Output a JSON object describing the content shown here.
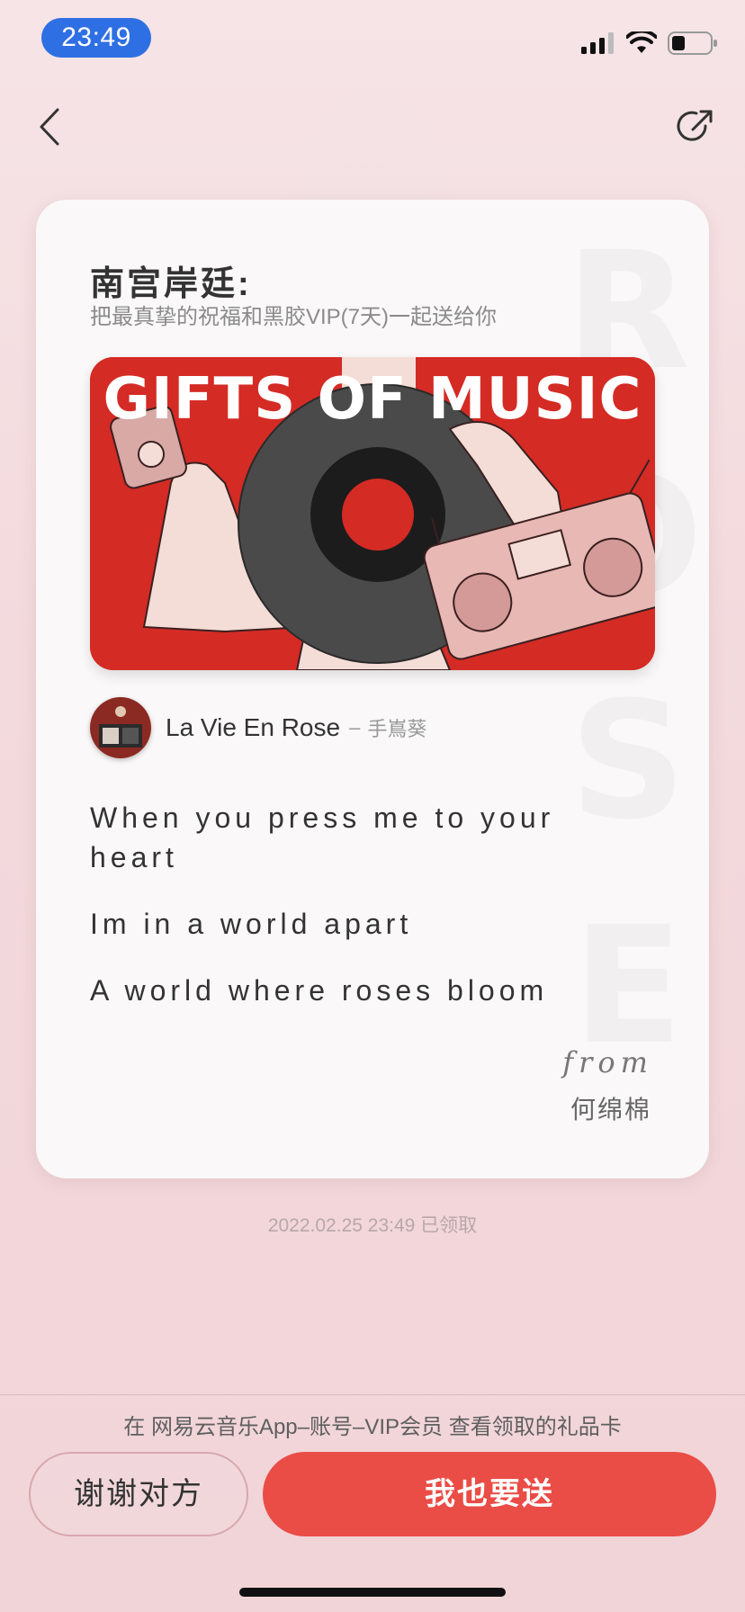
{
  "status_bar": {
    "time": "23:49",
    "signal_icon": "cellular-signal-icon",
    "wifi_icon": "wifi-icon",
    "battery_icon": "battery-icon",
    "battery_level": 0.3
  },
  "nav": {
    "back_icon": "chevron-left-icon",
    "share_icon": "share-arrow-icon"
  },
  "card": {
    "recipient": "南宫岸廷:",
    "subtitle": "把最真挚的祝福和黑胶VIP(7天)一起送给你",
    "banner_title": "GIFTS OF MUSIC",
    "watermark_letters": [
      "R",
      "O",
      "S",
      "E"
    ],
    "song": {
      "title": "La Vie En Rose",
      "separator": "–",
      "artist": "手嶌葵"
    },
    "lyrics": [
      "When you press me to your heart",
      "Im in a world apart",
      "A world where roses bloom"
    ],
    "from_label": "from",
    "from_name": "何绵棉"
  },
  "claimed_info": "2022.02.25 23:49 已领取",
  "footer": {
    "tip": "在 网易云音乐App–账号–VIP会员 查看领取的礼品卡",
    "thanks_button": "谢谢对方",
    "gift_button": "我也要送"
  },
  "colors": {
    "accent": "#ea4c46",
    "banner_red": "#d42b25",
    "time_pill": "#2f6fe4"
  }
}
